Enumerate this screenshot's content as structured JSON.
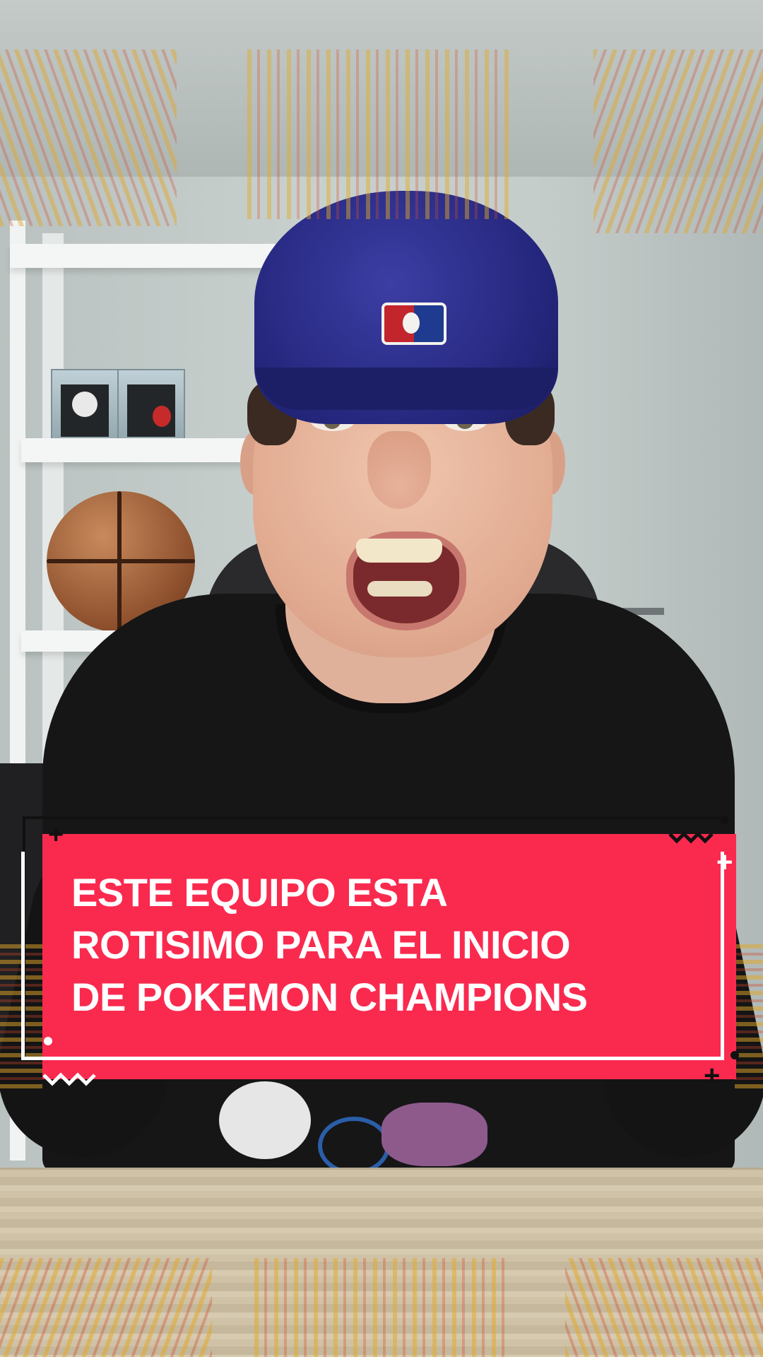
{
  "caption": {
    "lines": [
      "ESTE EQUIPO ESTA",
      "ROTISIMO PARA EL INICIO",
      "DE POKEMON CHAMPIONS"
    ],
    "background_color": "#fa2a4f",
    "text_color": "#ffffff"
  },
  "decorations": {
    "icons": [
      "plus-icon",
      "zigzag-icon",
      "dot-icon"
    ]
  }
}
